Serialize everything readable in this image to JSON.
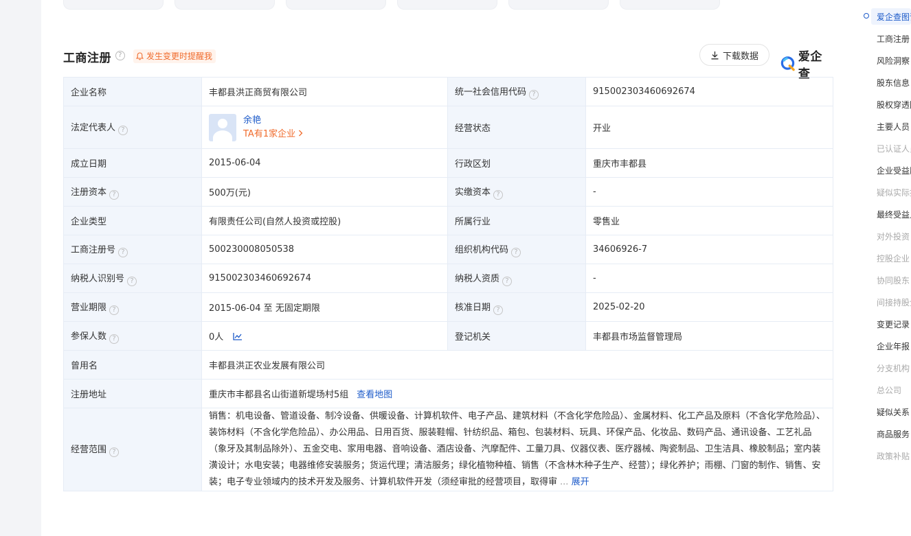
{
  "section": {
    "title": "工商注册",
    "help": "?",
    "remind_label": "发生变更时提醒我",
    "download_label": "下载数据",
    "brand": "爱企查"
  },
  "rows": {
    "name_label": "企业名称",
    "name_value": "丰都县洪正商贸有限公司",
    "credit_label": "统一社会信用代码",
    "credit_value": "915002303460692674",
    "legal_label": "法定代表人",
    "legal_name": "余艳",
    "legal_more": "TA有1家企业",
    "status_label": "经营状态",
    "status_value": "开业",
    "found_label": "成立日期",
    "found_value": "2015-06-04",
    "region_label": "行政区划",
    "region_value": "重庆市丰都县",
    "capital_label": "注册资本",
    "capital_value": "500万(元)",
    "paid_label": "实缴资本",
    "paid_value": "-",
    "type_label": "企业类型",
    "type_value": "有限责任公司(自然人投资或控股)",
    "industry_label": "所属行业",
    "industry_value": "零售业",
    "regno_label": "工商注册号",
    "regno_value": "500230008050538",
    "org_label": "组织机构代码",
    "org_value": "34606926-7",
    "taxid_label": "纳税人识别号",
    "taxid_value": "915002303460692674",
    "taxq_label": "纳税人资质",
    "taxq_value": "-",
    "term_label": "营业期限",
    "term_value": "2015-06-04 至 无固定期限",
    "approve_label": "核准日期",
    "approve_value": "2025-02-20",
    "insured_label": "参保人数",
    "insured_value": "0人",
    "authority_label": "登记机关",
    "authority_value": "丰都县市场监督管理局",
    "former_label": "曾用名",
    "former_value": "丰都县洪正农业发展有限公司",
    "address_label": "注册地址",
    "address_value": "重庆市丰都县名山街道新堤场村5组",
    "map_link": "查看地图",
    "scope_label": "经营范围",
    "scope_value": "销售：机电设备、管道设备、制冷设备、供暖设备、计算机软件、电子产品、建筑材料（不含化学危险品）、金属材料、化工产品及原料（不含化学危险品）、装饰材料（不含化学危险品）、办公用品、日用百货、服装鞋帽、针纺织品、箱包、包装材料、玩具、环保产品、化妆品、数码产品、通讯设备、工艺礼品（象牙及其制品除外）、五金交电、家用电器、音响设备、酒店设备、汽摩配件、工量刀具、仪器仪表、医疗器械、陶瓷制品、卫生洁具、橡胶制品；室内装潢设计；水电安装；电器维修安装服务；货运代理；清洁服务；绿化植物种植、销售（不含林木种子生产、经营）；绿化养护；雨棚、门窗的制作、销售、安装；电子专业领域内的技术开发及服务、计算机软件开发（须经审批的经营项目，取得审",
    "scope_ellipsis": "...",
    "scope_expand": "展开"
  },
  "sidebar": {
    "items": [
      {
        "label": "爱企查图谱",
        "state": "active"
      },
      {
        "label": "工商注册",
        "state": "normal"
      },
      {
        "label": "风险洞察",
        "state": "normal"
      },
      {
        "label": "股东信息",
        "state": "normal"
      },
      {
        "label": "股权穿透图",
        "state": "normal"
      },
      {
        "label": "主要人员",
        "state": "normal"
      },
      {
        "label": "已认证人员",
        "state": "muted"
      },
      {
        "label": "企业受益股东",
        "state": "normal"
      },
      {
        "label": "疑似实际控制人",
        "state": "muted"
      },
      {
        "label": "最终受益人",
        "state": "normal"
      },
      {
        "label": "对外投资",
        "state": "muted"
      },
      {
        "label": "控股企业",
        "state": "muted"
      },
      {
        "label": "协同股东",
        "state": "muted"
      },
      {
        "label": "间接持股企业",
        "state": "muted"
      },
      {
        "label": "变更记录",
        "state": "normal"
      },
      {
        "label": "企业年报",
        "state": "normal"
      },
      {
        "label": "分支机构",
        "state": "muted"
      },
      {
        "label": "总公司",
        "state": "muted"
      },
      {
        "label": "疑似关系",
        "state": "normal"
      },
      {
        "label": "商品服务",
        "state": "normal"
      },
      {
        "label": "政策补贴",
        "state": "muted"
      }
    ]
  },
  "colors": {
    "accent": "#1d5bc9",
    "orange": "#f06b2c",
    "label_bg": "#f2f6fc"
  }
}
